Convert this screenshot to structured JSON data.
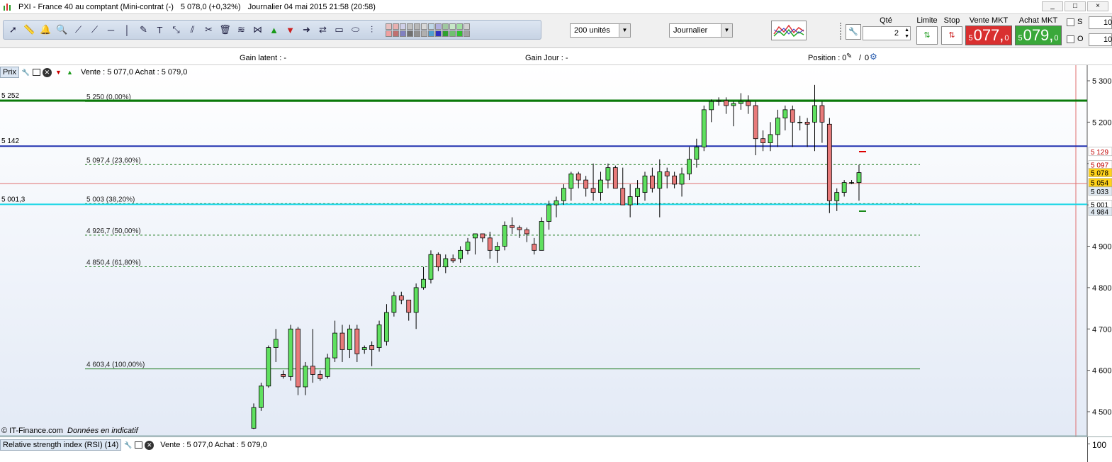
{
  "window": {
    "title": "PXI - France 40 au comptant (Mini-contrat  (-)",
    "last": "5 078,0 (+0,32%)",
    "period_time": "Journalier  04 mai 2015 21:58 (20:58)",
    "controls": [
      "_",
      "□",
      "×"
    ]
  },
  "toolbar": {
    "units_select": "200 unités",
    "period_select": "Journalier",
    "qty_label": "Qté",
    "qty_value": "2",
    "limit_label": "Limite",
    "stop_label": "Stop",
    "sell_label": "Vente MKT",
    "buy_label": "Achat MKT",
    "sell_small": "5",
    "sell_big": "077,",
    "sell_dec": "0",
    "buy_small": "5",
    "buy_big": "079,",
    "buy_dec": "0",
    "s_label": "S",
    "o_label": "O",
    "s_value": "10",
    "o_value": "10",
    "colors": [
      "#e8c0c0",
      "#e8b0b0",
      "#d0d0e8",
      "#c0c0c0",
      "#b8b8b8",
      "#d8d8d8",
      "#c0d8e8",
      "#b0b0e0",
      "#a0c8a0",
      "#c8e8c8",
      "#a0e0a0",
      "#d0d0d0",
      "#f0a0a0",
      "#c07070",
      "#8080c0",
      "#707070",
      "#909090",
      "#b0b0b0",
      "#50a0d0",
      "#3030c0",
      "#30a030",
      "#70c070",
      "#30c030",
      "#a0a0a0"
    ]
  },
  "infobar": {
    "gain_latent": "Gain latent : -",
    "gain_jour": "Gain Jour : -",
    "position_label": "Position : 0",
    "position_sep": "/",
    "position_value2": "0"
  },
  "price_pane": {
    "tag": "Prix",
    "quote": "Vente : 5 077,0  Achat : 5 079,0",
    "credit": "© IT-Finance.com",
    "credit_note": "Données en indicatif"
  },
  "rsi_pane": {
    "tag": "Relative strength index (RSI) (14)",
    "quote": "Vente : 5 077,0  Achat : 5 079,0",
    "axis_label": "100"
  },
  "chart_data": {
    "type": "candlestick",
    "ylim": [
      4450,
      5340
    ],
    "y_ticks": [
      4500,
      4600,
      4700,
      4800,
      4900,
      5000,
      5100,
      5200,
      5300
    ],
    "y_tick_labels": [
      "4 500",
      "4 600",
      "4 700",
      "4 800",
      "4 900",
      "5 000",
      "5 100",
      "5 200",
      "5 300"
    ],
    "horizontal_lines": [
      {
        "value": 5252,
        "left_label": "5 252",
        "color": "#0a7a0a",
        "style": "solid",
        "width": 3
      },
      {
        "value": 5142,
        "left_label": "5 142",
        "color": "#1f2fb0",
        "style": "solid",
        "width": 2
      },
      {
        "value": 5001.3,
        "left_label": "5 001,3",
        "color": "#19d6e6",
        "style": "solid",
        "width": 2
      }
    ],
    "fibonacci": [
      {
        "value": 5250,
        "label": "5 250 (0,00%)",
        "style": "solid"
      },
      {
        "value": 5097.4,
        "label": "5 097,4 (23,60%)",
        "style": "dashed"
      },
      {
        "value": 5003,
        "label": "5 003 (38,20%)",
        "style": "dashed"
      },
      {
        "value": 4926.7,
        "label": "4 926,7 (50,00%)",
        "style": "dashed"
      },
      {
        "value": 4850.4,
        "label": "4 850,4 (61,80%)",
        "style": "dashed"
      },
      {
        "value": 4603.4,
        "label": "4 603,4 (100,00%)",
        "style": "solid"
      }
    ],
    "price_tags": [
      {
        "value": 5129,
        "label": "5 129",
        "bg": "#ffffff",
        "fg": "#c00000"
      },
      {
        "value": 5097,
        "label": "5 097",
        "bg": "#ffffff",
        "fg": "#c00000"
      },
      {
        "value": 5078,
        "label": "5 078",
        "bg": "#ffd21a",
        "fg": "#000000"
      },
      {
        "value": 5054,
        "label": "5 054",
        "bg": "#ffd21a",
        "fg": "#000000"
      },
      {
        "value": 5033,
        "label": "5 033",
        "bg": "#dfe8f0",
        "fg": "#000000"
      },
      {
        "value": 5001,
        "label": "5 001",
        "bg": "#ffffff",
        "fg": "#000000"
      },
      {
        "value": 4984,
        "label": "4 984",
        "bg": "#dfe8f0",
        "fg": "#000000"
      }
    ],
    "candles": [
      [
        4460,
        4520,
        4458,
        4510
      ],
      [
        4510,
        4570,
        4502,
        4562
      ],
      [
        4562,
        4660,
        4558,
        4655
      ],
      [
        4655,
        4700,
        4620,
        4675
      ],
      [
        4590,
        4600,
        4580,
        4585
      ],
      [
        4585,
        4710,
        4575,
        4700
      ],
      [
        4700,
        4705,
        4540,
        4560
      ],
      [
        4560,
        4620,
        4540,
        4610
      ],
      [
        4610,
        4700,
        4570,
        4590
      ],
      [
        4590,
        4600,
        4575,
        4580
      ],
      [
        4585,
        4640,
        4580,
        4630
      ],
      [
        4630,
        4720,
        4620,
        4690
      ],
      [
        4690,
        4710,
        4620,
        4650
      ],
      [
        4650,
        4710,
        4630,
        4700
      ],
      [
        4700,
        4710,
        4620,
        4640
      ],
      [
        4650,
        4660,
        4640,
        4655
      ],
      [
        4660,
        4670,
        4610,
        4650
      ],
      [
        4655,
        4720,
        4645,
        4710
      ],
      [
        4670,
        4760,
        4660,
        4740
      ],
      [
        4740,
        4790,
        4730,
        4780
      ],
      [
        4780,
        4790,
        4760,
        4770
      ],
      [
        4770,
        4760,
        4720,
        4740
      ],
      [
        4740,
        4810,
        4700,
        4800
      ],
      [
        4800,
        4850,
        4795,
        4820
      ],
      [
        4820,
        4890,
        4810,
        4880
      ],
      [
        4880,
        4885,
        4840,
        4850
      ],
      [
        4850,
        4880,
        4835,
        4870
      ],
      [
        4870,
        4880,
        4860,
        4865
      ],
      [
        4870,
        4900,
        4860,
        4890
      ],
      [
        4890,
        4920,
        4880,
        4910
      ],
      [
        4920,
        4930,
        4880,
        4930
      ],
      [
        4930,
        4930,
        4910,
        4920
      ],
      [
        4920,
        4935,
        4870,
        4890
      ],
      [
        4890,
        4910,
        4860,
        4900
      ],
      [
        4900,
        4960,
        4890,
        4950
      ],
      [
        4950,
        4970,
        4930,
        4945
      ],
      [
        4945,
        4950,
        4920,
        4940
      ],
      [
        4940,
        4945,
        4910,
        4930
      ],
      [
        4905,
        4920,
        4880,
        4890
      ],
      [
        4890,
        4970,
        4890,
        4960
      ],
      [
        4960,
        5010,
        4940,
        5000
      ],
      [
        5000,
        5020,
        4970,
        5010
      ],
      [
        5010,
        5050,
        5000,
        5040
      ],
      [
        5040,
        5080,
        5010,
        5075
      ],
      [
        5075,
        5080,
        5040,
        5060
      ],
      [
        5060,
        5070,
        5020,
        5040
      ],
      [
        5040,
        5100,
        5010,
        5030
      ],
      [
        5030,
        5080,
        5010,
        5060
      ],
      [
        5060,
        5100,
        5040,
        5090
      ],
      [
        5090,
        5095,
        5050,
        5040
      ],
      [
        5040,
        5090,
        5000,
        5000
      ],
      [
        5000,
        5050,
        4970,
        5020
      ],
      [
        5020,
        5060,
        5000,
        5040
      ],
      [
        5030,
        5080,
        5010,
        5070
      ],
      [
        5070,
        5090,
        5030,
        5040
      ],
      [
        5040,
        5110,
        4970,
        5080
      ],
      [
        5080,
        5090,
        5040,
        5070
      ],
      [
        5070,
        5080,
        5040,
        5050
      ],
      [
        5050,
        5090,
        5020,
        5075
      ],
      [
        5075,
        5140,
        5060,
        5110
      ],
      [
        5110,
        5160,
        5090,
        5140
      ],
      [
        5140,
        5240,
        5130,
        5230
      ],
      [
        5230,
        5255,
        5200,
        5250
      ],
      [
        5250,
        5260,
        5240,
        5252
      ],
      [
        5252,
        5260,
        5220,
        5240
      ],
      [
        5240,
        5250,
        5190,
        5245
      ],
      [
        5245,
        5270,
        5230,
        5250
      ],
      [
        5250,
        5265,
        5220,
        5240
      ],
      [
        5240,
        5250,
        5120,
        5160
      ],
      [
        5160,
        5180,
        5130,
        5150
      ],
      [
        5150,
        5200,
        5130,
        5170
      ],
      [
        5170,
        5230,
        5140,
        5210
      ],
      [
        5210,
        5240,
        5180,
        5230
      ],
      [
        5230,
        5240,
        5140,
        5200
      ],
      [
        5200,
        5215,
        5180,
        5200
      ],
      [
        5200,
        5210,
        5140,
        5195
      ],
      [
        5200,
        5290,
        5130,
        5240
      ],
      [
        5240,
        5250,
        5150,
        5200
      ],
      [
        5195,
        5210,
        4980,
        5010
      ],
      [
        5010,
        5040,
        4985,
        5030
      ],
      [
        5030,
        5060,
        5020,
        5054
      ],
      [
        5054,
        5060,
        5050,
        5054
      ],
      [
        5054,
        5097,
        5010,
        5078
      ]
    ]
  }
}
